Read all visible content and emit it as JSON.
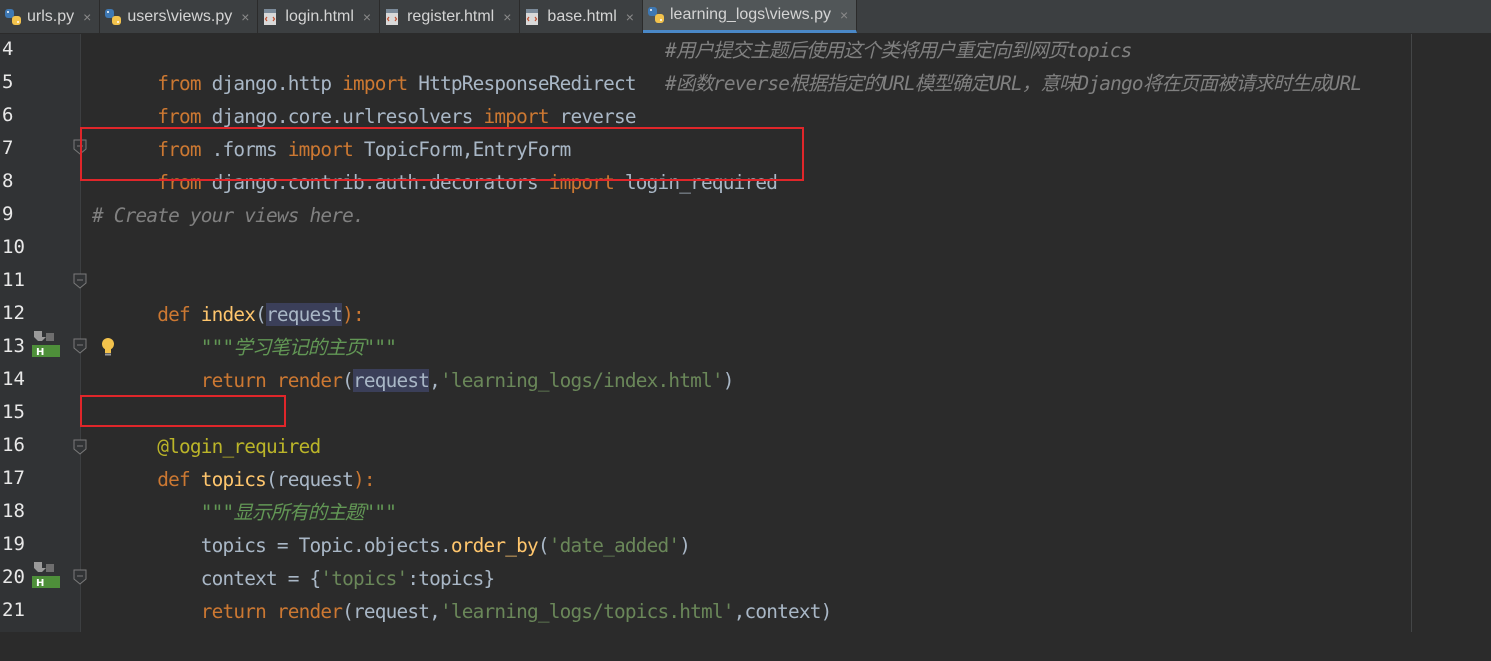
{
  "tabs": [
    {
      "label": "urls.py",
      "icon": "python-file-icon",
      "active": false
    },
    {
      "label": "users\\views.py",
      "icon": "python-file-icon",
      "active": false
    },
    {
      "label": "login.html",
      "icon": "html-file-icon",
      "active": false
    },
    {
      "label": "register.html",
      "icon": "html-file-icon",
      "active": false
    },
    {
      "label": "base.html",
      "icon": "html-file-icon",
      "active": false
    },
    {
      "label": "learning_logs\\views.py",
      "icon": "python-file-icon",
      "active": true
    }
  ],
  "line_numbers": [
    "4",
    "5",
    "6",
    "7",
    "8",
    "9",
    "10",
    "11",
    "12",
    "13",
    "14",
    "15",
    "16",
    "17",
    "18",
    "19",
    "20",
    "21"
  ],
  "code": {
    "l4": {
      "from": "from",
      "mod": " django.http ",
      "import": "import",
      "name": " HttpResponseRedirect",
      "comment": "#用户提交主题后使用这个类将用户重定向到网页topics"
    },
    "l5": {
      "from": "from",
      "mod": " django.core.urlresolvers ",
      "import": "import",
      "name": " reverse",
      "comment": "#函数reverse根据指定的URL模型确定URL，意味Django将在页面被请求时生成URL"
    },
    "l6": {
      "from": "from",
      "mod": " .forms ",
      "import": "import",
      "name": " TopicForm,EntryForm"
    },
    "l7": {
      "from": "from",
      "mod": " django.contrib.auth.decorators ",
      "import": "import",
      "name": " login_required"
    },
    "l9": {
      "comment": "# Create your views here."
    },
    "l11": {
      "def": "def",
      "fname": " index",
      "open": "(",
      "param": "request",
      "close": "):"
    },
    "l12": {
      "indent": "    ",
      "doc": "\"\"\"学习笔记的主页\"\"\""
    },
    "l13": {
      "indent": "    ",
      "return": "return",
      "sp": " ",
      "call": "render",
      "open": "(",
      "param": "request",
      "comma": ",",
      "str": "'learning_logs/index.html'",
      "close": ")"
    },
    "l15": {
      "deco": "@login_required"
    },
    "l16": {
      "def": "def",
      "fname": " topics",
      "open": "(",
      "param": "request",
      "close": "):"
    },
    "l17": {
      "indent": "    ",
      "doc": "\"\"\"显示所有的主题\"\"\""
    },
    "l18": {
      "indent": "    ",
      "lhs": "topics = Topic.objects.",
      "method": "order_by",
      "open": "(",
      "str": "'date_added'",
      "close": ")"
    },
    "l19": {
      "indent": "    ",
      "lhs": "context = {",
      "str": "'topics'",
      "rest": ":topics}"
    },
    "l20": {
      "indent": "    ",
      "return": "return",
      "sp": " ",
      "call": "render",
      "open": "(",
      "param": "request",
      "comma": ",",
      "str": "'learning_logs/topics.html'",
      "rest": ",context)"
    }
  },
  "colors": {
    "background": "#2b2b2b",
    "keyword": "#cc7832",
    "string": "#6a8759",
    "comment": "#808080",
    "decorator": "#bbb529",
    "highlight_box": "#e0262a"
  }
}
